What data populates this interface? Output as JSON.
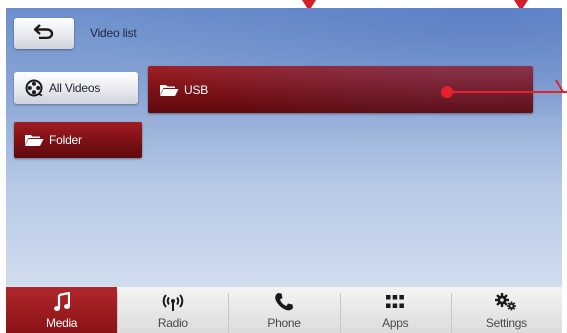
{
  "header": {
    "title": "Video list"
  },
  "buttons": {
    "all_videos": "All Videos",
    "usb": "USB",
    "folder": "Folder"
  },
  "navbar": {
    "items": [
      {
        "label": "Media",
        "icon": "music-note-icon",
        "active": true
      },
      {
        "label": "Radio",
        "icon": "radio-signal-icon",
        "active": false
      },
      {
        "label": "Phone",
        "icon": "phone-icon",
        "active": false
      },
      {
        "label": "Apps",
        "icon": "apps-grid-icon",
        "active": false
      },
      {
        "label": "Settings",
        "icon": "gear-icon",
        "active": false
      }
    ]
  },
  "colors": {
    "accent": "#8a1216",
    "callout": "#e3222c"
  }
}
